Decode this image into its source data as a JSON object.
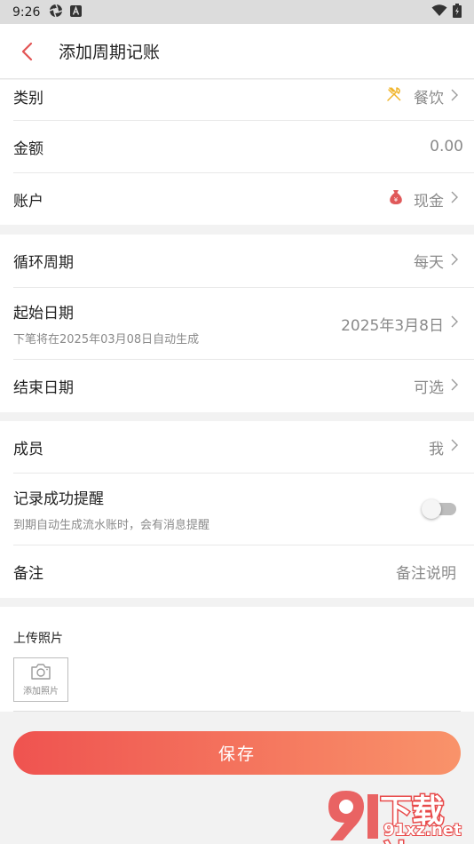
{
  "status_bar": {
    "time": "9:26"
  },
  "header": {
    "title": "添加周期记账"
  },
  "section1": {
    "category": {
      "label": "类别",
      "value": "餐饮"
    },
    "amount": {
      "label": "金额",
      "value": "0.00"
    },
    "account": {
      "label": "账户",
      "value": "现金"
    }
  },
  "section2": {
    "cycle": {
      "label": "循环周期",
      "value": "每天"
    },
    "start_date": {
      "label": "起始日期",
      "sub": "下笔将在2025年03月08日自动生成",
      "value": "2025年3月8日"
    },
    "end_date": {
      "label": "结束日期",
      "value": "可选"
    }
  },
  "section3": {
    "member": {
      "label": "成员",
      "value": "我"
    },
    "reminder": {
      "label": "记录成功提醒",
      "sub": "到期自动生成流水账时，会有消息提醒",
      "enabled": false
    },
    "note": {
      "label": "备注",
      "placeholder": "备注说明"
    }
  },
  "upload": {
    "label": "上传照片",
    "add_text": "添加照片"
  },
  "save_button": {
    "label": "保存"
  },
  "watermark": {
    "line1": "下载站",
    "line2": "91xz.net"
  },
  "colors": {
    "accent": "#ef5350",
    "gradient_end": "#f9936a",
    "category_icon": "#f0b429",
    "account_icon": "#e0595a"
  }
}
